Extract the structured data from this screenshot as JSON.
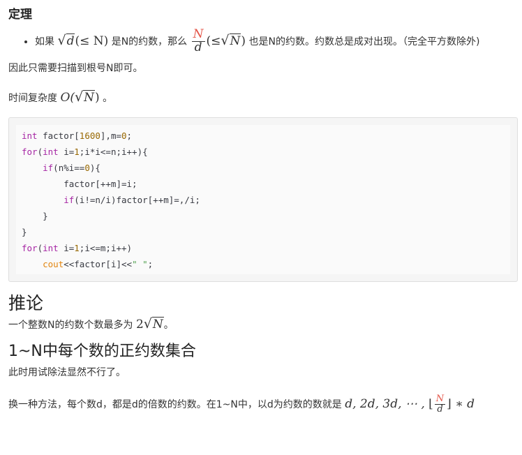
{
  "theorem": {
    "heading": "定理",
    "bullet_prefix": "如果",
    "bullet_part1": "是N的约数，那么",
    "bullet_part2": "也是N的约数。约数总是成对出现。（完全平方数除外)",
    "math_sqrt_d": "d",
    "math_le_n": "(≤ N)",
    "math_frac_num": "N",
    "math_frac_den": "d",
    "math_le_sqrt_open": "(≤",
    "math_sqrt_n": "N",
    "math_close": ")"
  },
  "paragraphs": {
    "scan": "因此只需要扫描到根号N即可。",
    "complexity_label": "时间复杂度",
    "complexity_O": "O(",
    "complexity_arg": "N",
    "complexity_close": ")",
    "complexity_end": "。"
  },
  "code": {
    "lines": [
      "int factor[1600],m=0;",
      "for(int i=1;i*i<=n;i++){",
      "    if(n%i==0){",
      "        factor[++m]=i;",
      "        if(i!=n/i)factor[++m]=,/i;",
      "    }",
      "}",
      "for(int i=1;i<=m;i++)",
      "    cout<<factor[i]<<\" \";"
    ]
  },
  "corollary": {
    "heading": "推论",
    "text_prefix": "一个整数N的约数个数最多为",
    "math_coef": "2",
    "math_sqrt": "N",
    "text_suffix": "。"
  },
  "section": {
    "heading": "1~N中每个数的正约数集合",
    "line1": "此时用试除法显然不行了。",
    "line2_prefix": "换一种方法，每个数d，都是d的倍数的约数。在1~N中，以d为约数的数就是",
    "line2_math_seq": "d, 2d, 3d, ⋯ , ",
    "line2_math_floor_open": "⌊",
    "line2_math_num": "N",
    "line2_math_den": "d",
    "line2_math_floor_close": "⌋",
    "line2_math_tail": "∗ d"
  }
}
